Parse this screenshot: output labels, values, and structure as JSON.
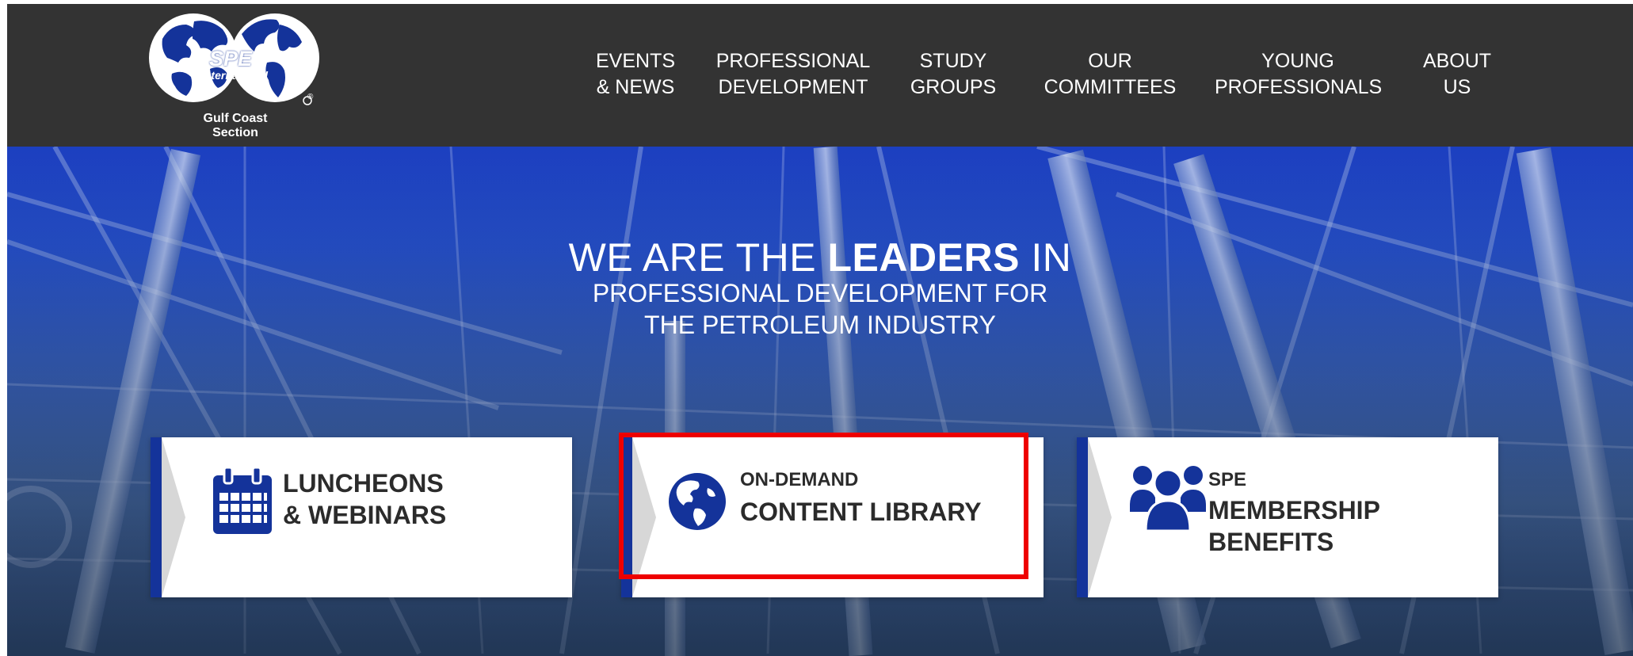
{
  "brand": {
    "logo_word": "SPE",
    "logo_sub": "International",
    "caption": "Gulf Coast Section",
    "registered": "®"
  },
  "nav": {
    "items": [
      {
        "line1": "EVENTS",
        "line2": "& NEWS"
      },
      {
        "line1": "PROFESSIONAL",
        "line2": "DEVELOPMENT"
      },
      {
        "line1": "STUDY",
        "line2": "GROUPS"
      },
      {
        "line1": "OUR",
        "line2": "COMMITTEES"
      },
      {
        "line1": "YOUNG",
        "line2": "PROFESSIONALS"
      },
      {
        "line1": "ABOUT",
        "line2": "US"
      }
    ]
  },
  "hero": {
    "title_pre": "WE ARE THE ",
    "title_bold": "LEADERS",
    "title_post": " IN",
    "sub_line1": "PROFESSIONAL DEVELOPMENT FOR",
    "sub_line2": "THE PETROLEUM INDUSTRY"
  },
  "cards": [
    {
      "line1": "LUNCHEONS",
      "line2": "& WEBINARS",
      "icon": "calendar-icon"
    },
    {
      "kicker": "ON-DEMAND",
      "line1": "CONTENT LIBRARY",
      "icon": "globe-icon"
    },
    {
      "kicker": "SPE",
      "line1": "MEMBERSHIP",
      "line2": "BENEFITS",
      "icon": "users-icon"
    }
  ],
  "colors": {
    "header_bg": "#333333",
    "accent_blue": "#14339a",
    "highlight": "#ee0000"
  }
}
